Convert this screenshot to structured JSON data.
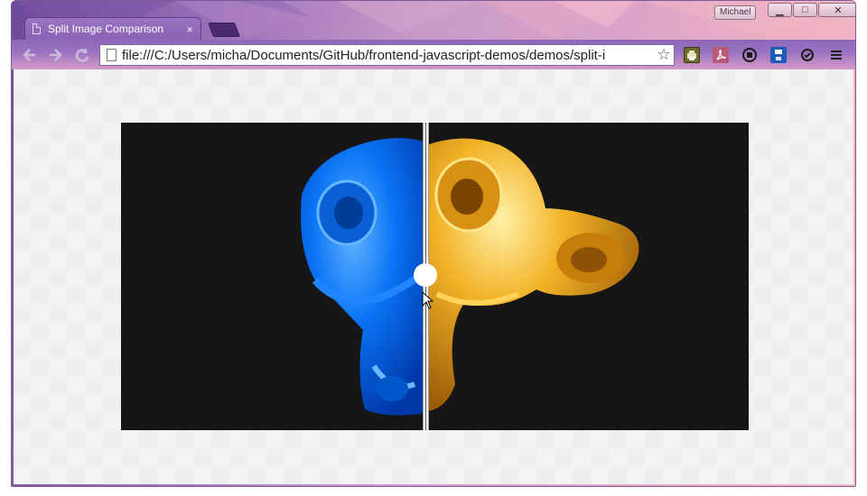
{
  "browser": {
    "user_name": "Michael",
    "tab": {
      "title": "Split Image Comparison",
      "close_glyph": "×"
    },
    "url": "file:///C:/Users/micha/Documents/GitHub/frontend-javascript-demos/demos/split-i",
    "window_buttons": {
      "minimize": "▁",
      "maximize": "□",
      "close": "✕"
    },
    "nav_icons": [
      "back-icon",
      "forward-icon",
      "reload-icon"
    ],
    "extensions": [
      "print-icon",
      "pdf-icon",
      "record-icon",
      "save-icon",
      "sync-icon",
      "menu-icon"
    ]
  },
  "comparison": {
    "left_image": "blue-monkey-head",
    "right_image": "gold-monkey-head",
    "split_position": 0.49,
    "colors": {
      "left": "#0a74f5",
      "right": "#f2b327",
      "background": "#161616"
    }
  }
}
